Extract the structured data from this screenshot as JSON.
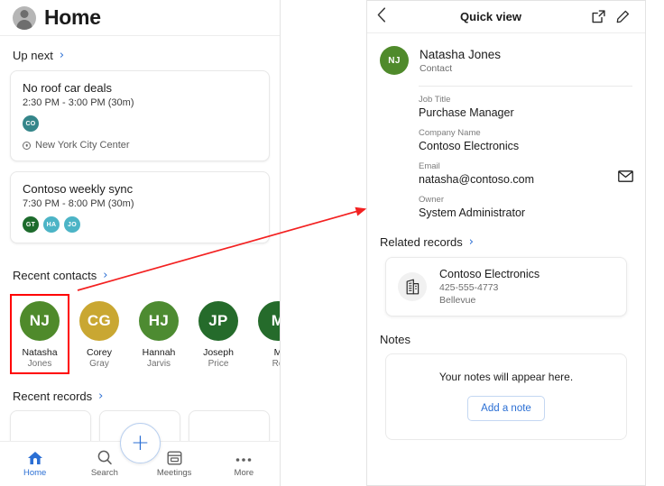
{
  "left_panel": {
    "header": {
      "title": "Home",
      "avatar_icon": "person-avatar-icon"
    },
    "up_next": {
      "label": "Up next",
      "chevron": "›",
      "meetings": [
        {
          "title": "No roof car deals",
          "time": "2:30 PM - 3:00 PM (30m)",
          "attendees": [
            {
              "initials": "CO",
              "color": "#35868a"
            }
          ],
          "location": "New York City Center",
          "location_icon": "location-pin-icon"
        },
        {
          "title": "Contoso weekly sync",
          "time": "7:30 PM - 8:00 PM (30m)",
          "attendees": [
            {
              "initials": "GT",
              "color": "#1d6b2c"
            },
            {
              "initials": "HA",
              "color": "#4cb4c6"
            },
            {
              "initials": "JO",
              "color": "#4cb4c6"
            }
          ],
          "location": "",
          "location_icon": ""
        }
      ]
    },
    "recent_contacts": {
      "label": "Recent contacts",
      "chevron": "›",
      "contacts": [
        {
          "initials": "NJ",
          "first": "Natasha",
          "last": "Jones",
          "color": "#4f8a2b",
          "selected": true
        },
        {
          "initials": "CG",
          "first": "Corey",
          "last": "Gray",
          "color": "#c9a732",
          "selected": false
        },
        {
          "initials": "HJ",
          "first": "Hannah",
          "last": "Jarvis",
          "color": "#4d8b31",
          "selected": false
        },
        {
          "initials": "JP",
          "first": "Joseph",
          "last": "Price",
          "color": "#256b2b",
          "selected": false
        },
        {
          "initials": "M",
          "first": "M",
          "last": "Ro",
          "color": "#256b2b",
          "selected": false
        }
      ]
    },
    "recent_records": {
      "label": "Recent records",
      "chevron": "›"
    },
    "bottom_nav": {
      "items": [
        {
          "label": "Home",
          "icon": "home-icon",
          "active": true
        },
        {
          "label": "Search",
          "icon": "search-icon",
          "active": false
        },
        {
          "label": "Meetings",
          "icon": "meetings-icon",
          "active": false
        },
        {
          "label": "More",
          "icon": "more-icon",
          "active": false
        }
      ],
      "fab": {
        "label": "+",
        "icon": "add-icon"
      }
    }
  },
  "right_panel": {
    "header": {
      "back_icon": "chevron-left-icon",
      "title": "Quick view",
      "open_icon": "open-in-new-icon",
      "edit_icon": "pencil-edit-icon"
    },
    "person": {
      "initials": "NJ",
      "avatar_color": "#4f8a2b",
      "name": "Natasha Jones",
      "type": "Contact"
    },
    "fields": [
      {
        "label": "Job Title",
        "value": "Purchase Manager",
        "action_icon": ""
      },
      {
        "label": "Company Name",
        "value": "Contoso Electronics",
        "action_icon": ""
      },
      {
        "label": "Email",
        "value": "natasha@contoso.com",
        "action_icon": "mail-icon"
      },
      {
        "label": "Owner",
        "value": "System Administrator",
        "action_icon": ""
      }
    ],
    "related_records": {
      "label": "Related records",
      "chevron": "›",
      "items": [
        {
          "icon": "building-icon",
          "name": "Contoso Electronics",
          "phone": "425-555-4773",
          "city": "Bellevue"
        }
      ]
    },
    "notes": {
      "label": "Notes",
      "empty_text": "Your notes will appear here.",
      "add_button": "Add a note"
    }
  },
  "annotation": {
    "arrow_color": "#f32121",
    "highlight_color": "#ff0000"
  }
}
